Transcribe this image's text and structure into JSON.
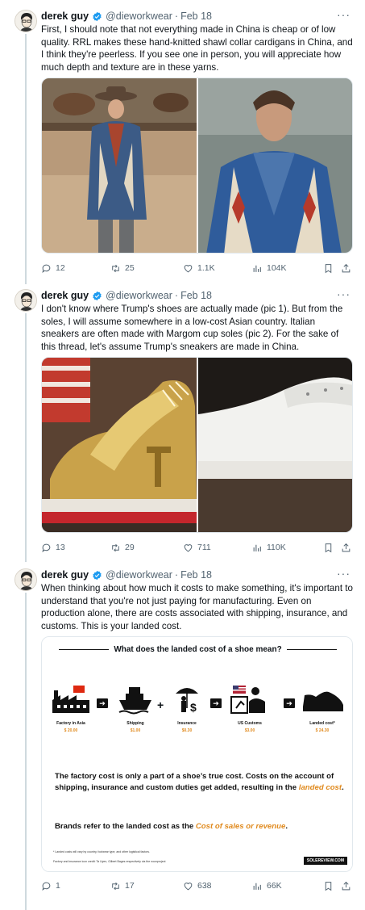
{
  "tweets": [
    {
      "name": "derek guy",
      "handle": "@dieworkwear",
      "date": "Feb 18",
      "text": "First, I should note that not everything made in China is cheap or of low quality. RRL makes these hand-knitted shawl collar cardigans in China, and I think they're peerless. If you see one in person, you will appreciate how much depth and texture are in these yarns.",
      "replies": "12",
      "retweets": "25",
      "likes": "1.1K",
      "views": "104K"
    },
    {
      "name": "derek guy",
      "handle": "@dieworkwear",
      "date": "Feb 18",
      "text": "I don't know where Trump's shoes are actually made (pic 1). But from the soles, I will assume somewhere in a low-cost Asian country. Italian sneakers are often made with Margom cup soles (pic 2). For the sake of this thread, let's assume Trump's sneakers are made in China.",
      "replies": "13",
      "retweets": "29",
      "likes": "711",
      "views": "110K"
    },
    {
      "name": "derek guy",
      "handle": "@dieworkwear",
      "date": "Feb 18",
      "text": "When thinking about how much it costs to make something, it's important to understand that you're not just paying for manufacturing. Even on production alone, there are costs associated with shipping, insurance, and customs. This is your landed cost.",
      "replies": "1",
      "retweets": "17",
      "likes": "638",
      "views": "66K"
    }
  ],
  "infographic": {
    "title": "What does the landed cost of a shoe mean?",
    "stages": [
      {
        "label": "Factory in Asia",
        "value": "$ 20.00"
      },
      {
        "label": "Shipping",
        "value": "$1.00"
      },
      {
        "label": "Insurance",
        "value": "$0.30"
      },
      {
        "label": "US Customs",
        "value": "$3.00"
      },
      {
        "label": "Landed cost*",
        "value": "$ 24.30"
      }
    ],
    "para1_a": "The factory cost is only a part of a shoe’s true cost. Costs on the account of shipping, insurance and custom duties get added, resulting in the ",
    "para1_hl": "landed cost",
    "para1_b": ".",
    "para2_a": "Brands refer to the landed cost as the ",
    "para2_hl": "Cost of sales or revenue",
    "para2_b": ".",
    "footnote1": "* Landed costs will vary by country, footwear type,  and other logistical factors.",
    "footnote2": "Factory and insurance icon credit: Ta Uyen, Gilbert Bages respectively via the nounproject",
    "source_tag": "SOLEREVIEW.COM"
  },
  "icons": [
    "verified-badge-icon",
    "more-icon",
    "reply-icon",
    "retweet-icon",
    "like-icon",
    "views-icon",
    "bookmark-icon",
    "share-icon"
  ],
  "colors": {
    "verified": "#1d9bf0",
    "accent": "#e08a1e",
    "muted": "#536471"
  }
}
